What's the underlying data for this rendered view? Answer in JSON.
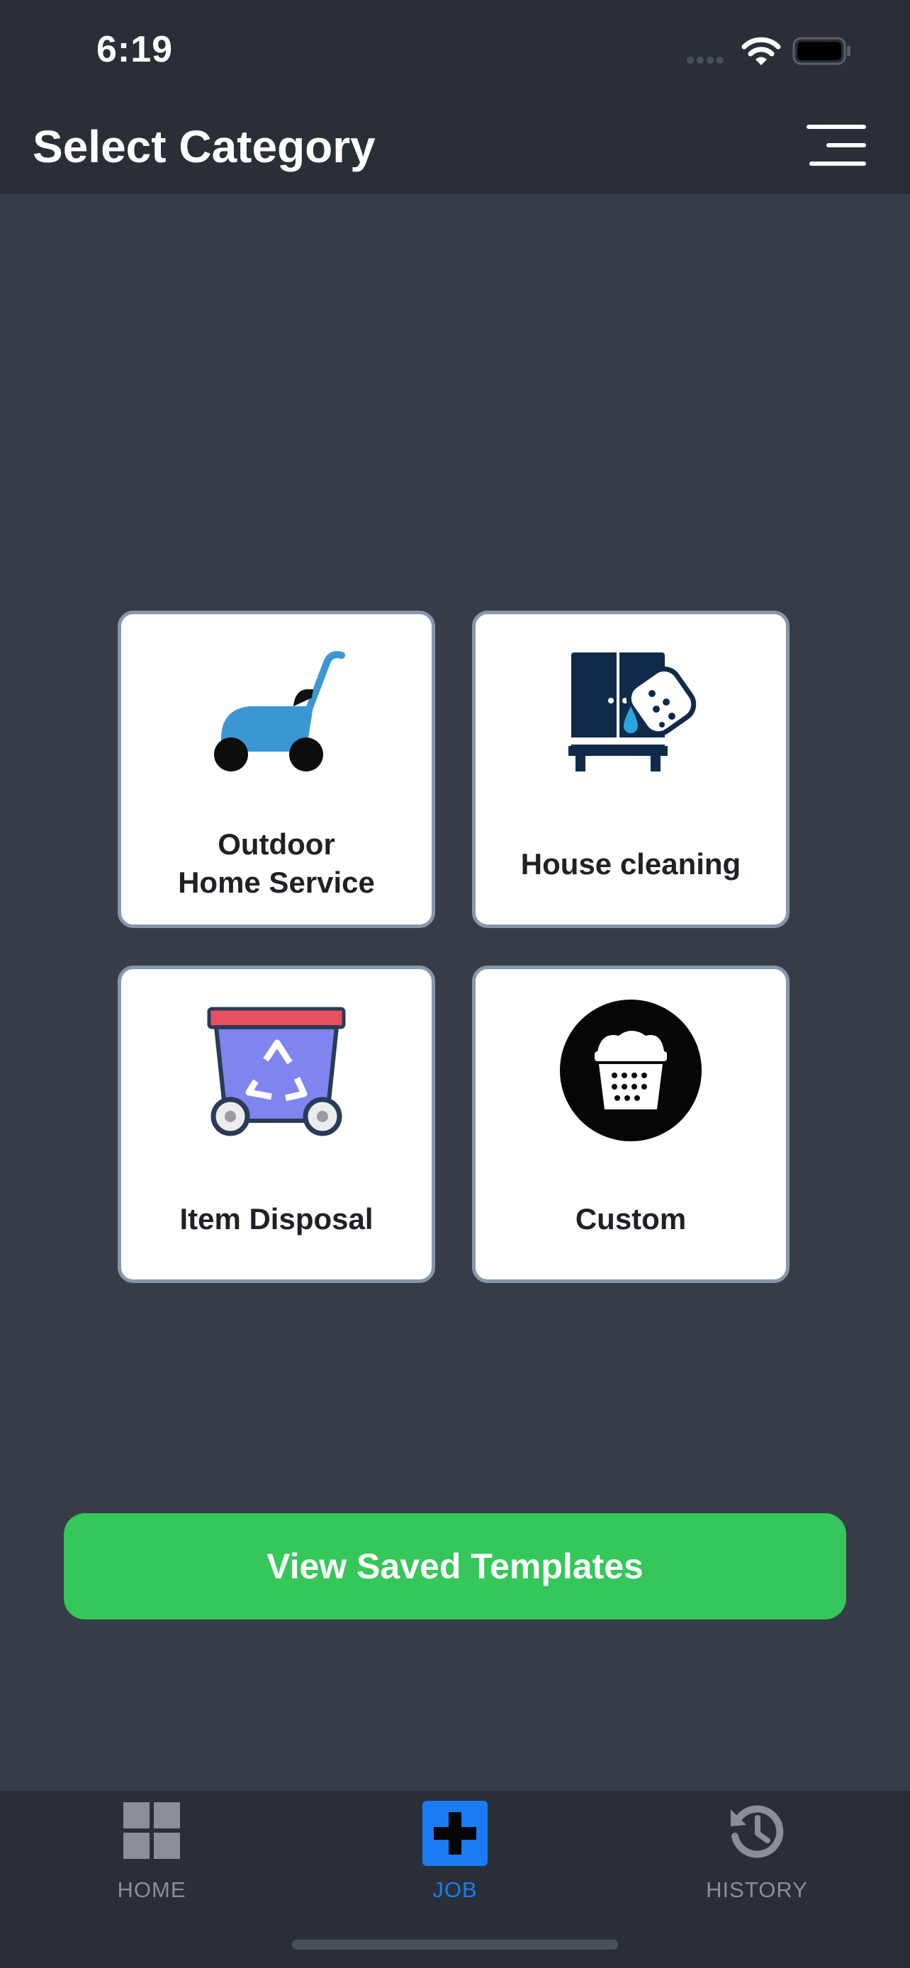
{
  "status_bar": {
    "time": "6:19"
  },
  "header": {
    "title": "Select Category"
  },
  "categories": [
    {
      "label_line1": "Outdoor",
      "label_line2": "Home Service",
      "icon": "lawn-mower-icon"
    },
    {
      "label": "House cleaning",
      "icon": "cabinet-sponge-icon"
    },
    {
      "label": "Item Disposal",
      "icon": "recycling-dumpster-icon"
    },
    {
      "label": "Custom",
      "icon": "laundry-basket-icon"
    }
  ],
  "templates_button": {
    "label": "View Saved Templates",
    "color": "#35c759"
  },
  "tab_bar": {
    "active_color": "#1a7cf5",
    "inactive_color": "#8a8f96",
    "tabs": [
      {
        "label": "HOME",
        "icon": "grid-icon",
        "active": false
      },
      {
        "label": "JOB",
        "icon": "plus-square-icon",
        "active": true
      },
      {
        "label": "HISTORY",
        "icon": "history-icon",
        "active": false
      }
    ]
  }
}
